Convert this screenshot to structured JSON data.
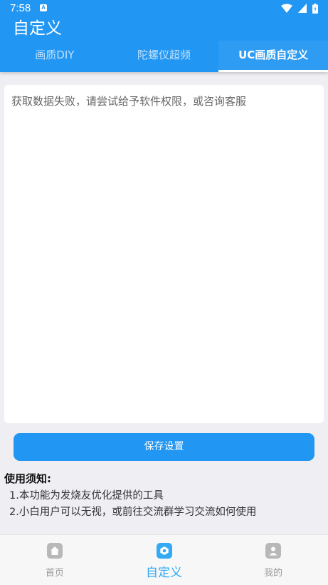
{
  "status_bar": {
    "time": "7:58",
    "notification_icon": "A",
    "icons": [
      "wifi-icon",
      "signal-icon",
      "battery-icon"
    ]
  },
  "app": {
    "title": "自定义"
  },
  "tabs": [
    {
      "label": "画质DIY",
      "active": false
    },
    {
      "label": "陀螺仪超频",
      "active": false
    },
    {
      "label": "UC画质自定义",
      "active": true
    }
  ],
  "config_panel": {
    "text": "获取数据失败，请尝试给予软件权限，或咨询客服"
  },
  "save_button": {
    "label": "保存设置"
  },
  "notice": {
    "title": "使用须知:",
    "items": [
      "1.本功能为发烧友优化提供的工具",
      "2.小白用户可以无视，或前往交流群学习交流如何使用"
    ]
  },
  "bottom_nav": [
    {
      "label": "首页",
      "icon": "home-icon",
      "active": false
    },
    {
      "label": "自定义",
      "icon": "customize-icon",
      "active": true
    },
    {
      "label": "我的",
      "icon": "profile-icon",
      "active": false
    }
  ],
  "colors": {
    "primary": "#2196f3",
    "nav_active": "#33aaf5",
    "background": "#efeef3"
  }
}
